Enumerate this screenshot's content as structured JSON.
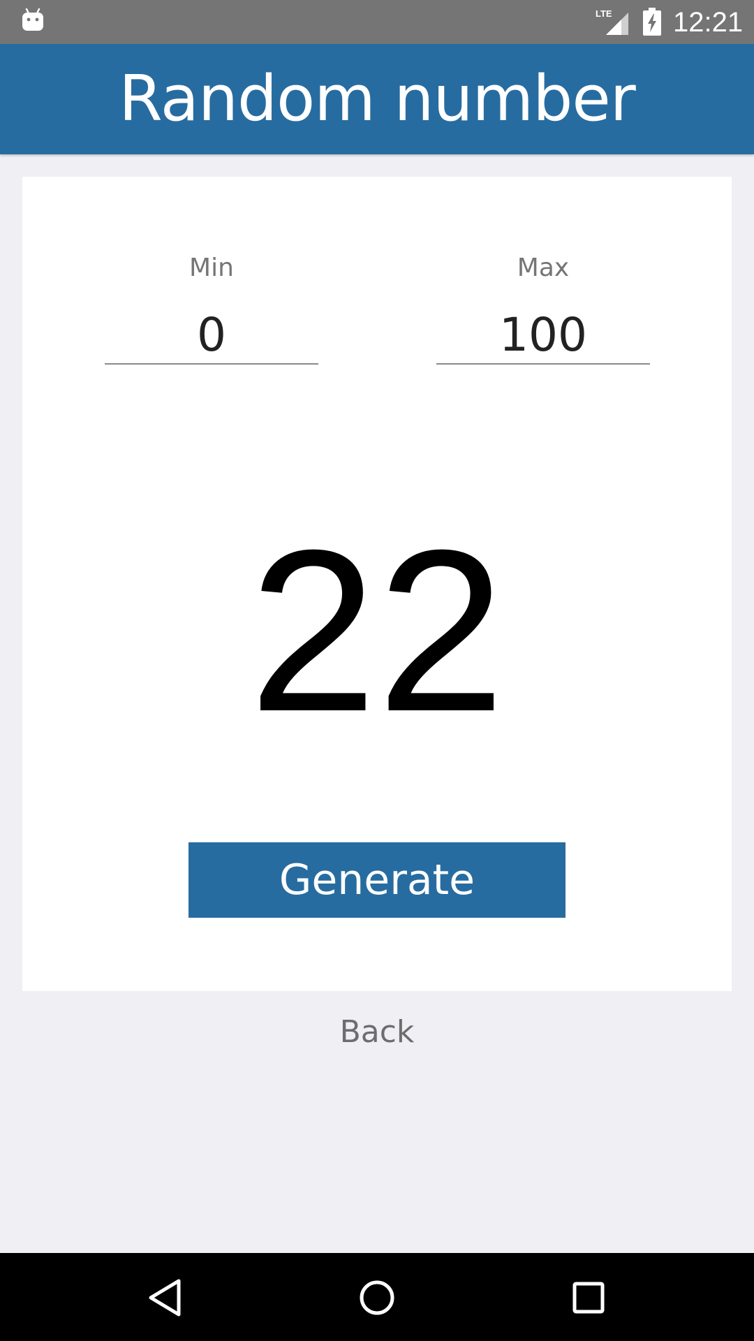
{
  "status_bar": {
    "time": "12:21",
    "network": "LTE",
    "icons": [
      "android-icon",
      "lte-signal-icon",
      "battery-charging-icon"
    ]
  },
  "header": {
    "title": "Random number"
  },
  "form": {
    "min_label": "Min",
    "min_value": "0",
    "max_label": "Max",
    "max_value": "100"
  },
  "result": {
    "value": "22"
  },
  "actions": {
    "generate_label": "Generate",
    "back_label": "Back"
  },
  "nav_bar": {
    "icons": [
      "back-icon",
      "home-icon",
      "recents-icon"
    ]
  },
  "colors": {
    "primary": "#276ca0",
    "background": "#efeff4",
    "status_bar": "#757575"
  }
}
